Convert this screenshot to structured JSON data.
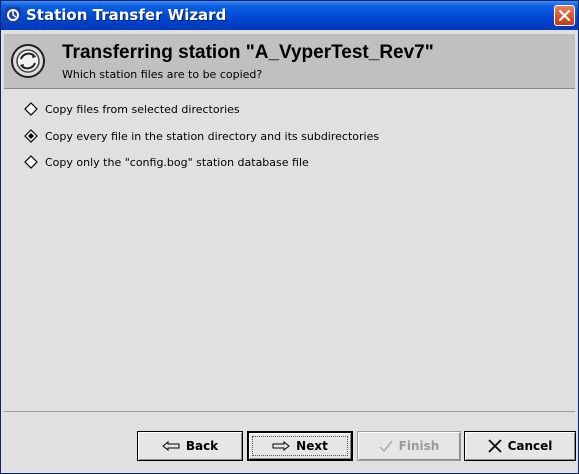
{
  "window": {
    "title": "Station Transfer Wizard"
  },
  "header": {
    "title": "Transferring station \"A_VyperTest_Rev7\"",
    "subtitle": "Which station files are to be copied?"
  },
  "options": [
    {
      "label": "Copy files from selected directories",
      "selected": false
    },
    {
      "label": "Copy every file in the station directory and its subdirectories",
      "selected": true
    },
    {
      "label": "Copy only the \"config.bog\" station database file",
      "selected": false
    }
  ],
  "buttons": {
    "back": "Back",
    "next": "Next",
    "finish": "Finish",
    "cancel": "Cancel"
  },
  "colors": {
    "titlebar": "#0049d4",
    "header_band": "#c0c0c0",
    "body": "#e0e0e0",
    "close": "#d8542b"
  }
}
